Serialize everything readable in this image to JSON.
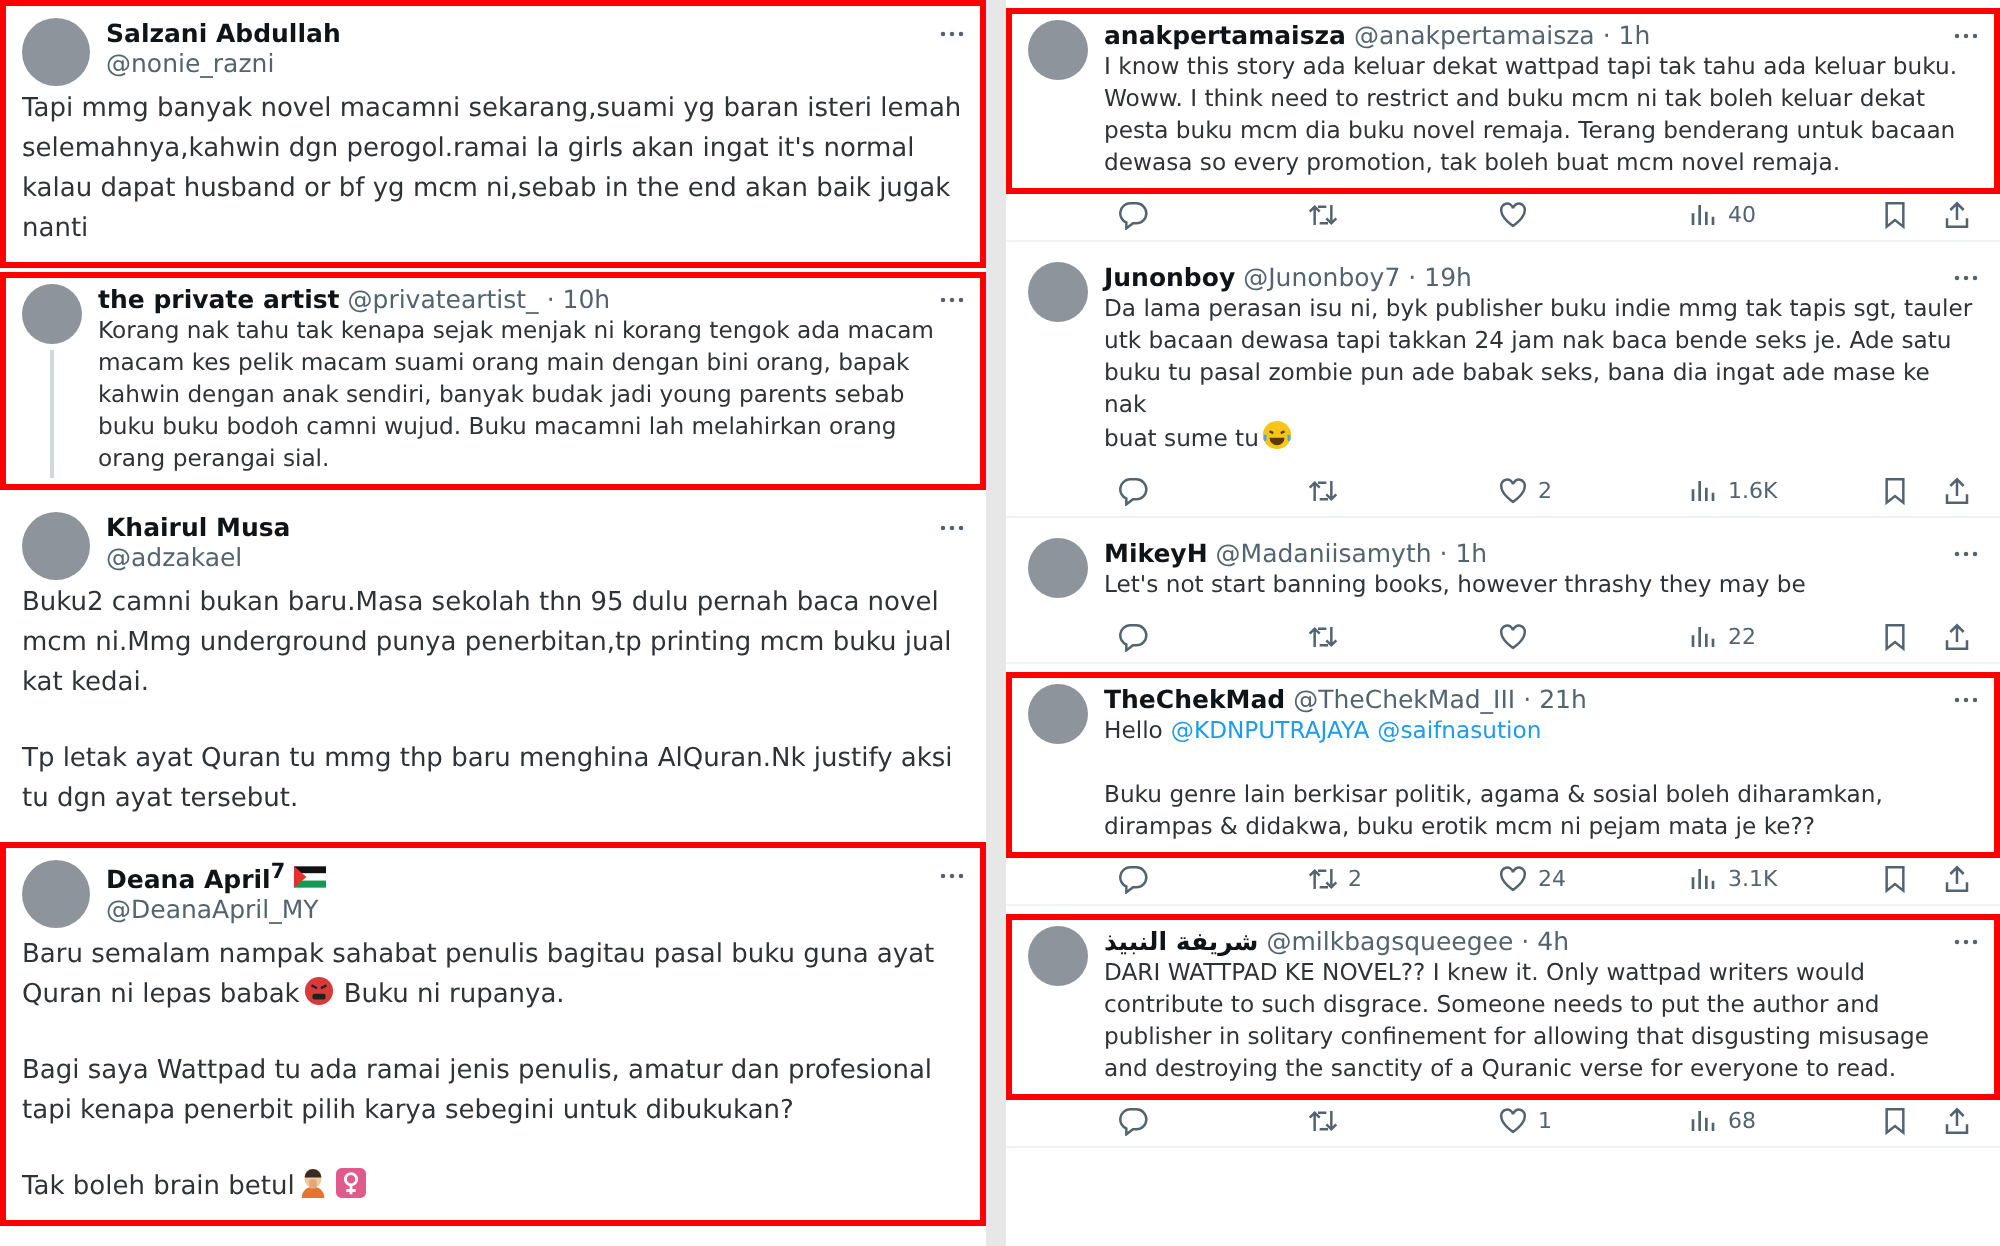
{
  "left_column": [
    {
      "kind": "detail",
      "highlighted": true,
      "name": "Salzani Abdullah",
      "handle": "@nonie_razni",
      "body": [
        [
          {
            "kind": "text",
            "text": "Tapi mmg banyak novel macamni sekarang,suami yg baran isteri lemah selemahnya,kahwin dgn perogol.ramai la girls akan ingat it's normal kalau dapat husband or bf yg mcm ni,sebab in the end akan baik jugak nanti"
          }
        ]
      ]
    },
    {
      "kind": "compact",
      "highlighted": true,
      "thread_line": true,
      "name": "the private artist",
      "handle": "@privateartist_",
      "time": "· 10h",
      "body": [
        [
          {
            "kind": "text",
            "text": "Korang nak tahu tak kenapa sejak menjak ni korang tengok ada macam macam kes pelik macam suami orang main dengan bini orang, bapak kahwin dengan anak sendiri, banyak budak jadi young parents sebab buku buku bodoh camni wujud. Buku macamni lah melahirkan orang orang perangai sial."
          }
        ]
      ]
    },
    {
      "kind": "detail",
      "highlighted": false,
      "name": "Khairul Musa",
      "handle": "@adzakael",
      "body": [
        [
          {
            "kind": "text",
            "text": "Buku2 camni bukan baru.Masa sekolah thn 95 dulu pernah baca novel mcm ni.Mmg underground punya penerbitan,tp printing mcm buku jual kat kedai."
          }
        ],
        [
          {
            "kind": "text",
            "text": "Tp letak ayat Quran tu mmg thp baru menghina AlQuran.Nk justify aksi tu dgn ayat tersebut."
          }
        ]
      ]
    },
    {
      "kind": "detail",
      "highlighted": true,
      "name": "Deana April$^{7}$",
      "flag": true,
      "handle": "@DeanaApril_MY",
      "body": [
        [
          {
            "kind": "text",
            "text": "Baru semalam nampak sahabat penulis bagitau pasal buku guna ayat"
          },
          {
            "kind": "text",
            "text": "Quran ni lepas babak"
          },
          {
            "kind": "icon"
          },
          {
            "kind": "text",
            "text": "Buku ni rupanya."
          }
        ],
        [
          {
            "kind": "text",
            "text": "Bagi saya Wattpad tu ada ramai jenis penulis, amatur dan profesional tapi kenapa penerbit pilih karya sebegini untuk dibukukan?"
          }
        ],
        [
          {
            "kind": "text",
            "text": "Tak boleh brain betul"
          },
          {
            "kind": "icon"
          },
          {
            "kind": "icon"
          }
        ]
      ]
    }
  ],
  "right_column": [
    {
      "highlighted": true,
      "name": "anakpertamaisza",
      "handle": "@anakpertamaisza",
      "time": "· 1h",
      "body": [
        [
          {
            "kind": "text",
            "text": "I know this story ada keluar dekat wattpad tapi tak tahu ada keluar buku. Woww. I think need to restrict and buku mcm ni tak boleh keluar dekat pesta buku mcm dia buku novel remaja. Terang benderang untuk bacaan dewasa so every promotion, tak boleh buat mcm novel remaja."
          }
        ]
      ],
      "stats": {
        "views": "40"
      }
    },
    {
      "highlighted": false,
      "name": "Junonboy",
      "handle": "@Junonboy7",
      "time": "· 19h",
      "body": [
        [
          {
            "kind": "text",
            "text": "Da lama perasan isu ni, byk publisher buku indie mmg tak tapis sgt, tauler utk bacaan dewasa tapi takkan 24 jam nak baca bende seks je. Ade satu buku tu pasal zombie pun ade babak seks, bana dia ingat ade mase ke nak"
          },
          {
            "kind": "text",
            "text": "buat sume tu"
          },
          {
            "kind": "icon"
          }
        ]
      ],
      "stats": {
        "likes": "2",
        "views": "1.6K"
      }
    },
    {
      "highlighted": false,
      "name": "MikeyH",
      "handle": "@Madaniisamyth",
      "time": "· 1h",
      "body": [
        [
          {
            "kind": "text",
            "text": "Let's not start banning books, however thrashy they may be"
          }
        ]
      ],
      "stats": {
        "views": "22"
      }
    },
    {
      "highlighted": true,
      "name": "TheChekMad",
      "handle": "@TheChekMad_III",
      "time": "· 21h",
      "body": [
        [
          {
            "kind": "text",
            "text": "Hello"
          },
          {
            "kind": "mention",
            "text": "@KDNPUTRAJAYA"
          },
          {
            "kind": "mention",
            "text": "@saifnasution"
          }
        ],
        [
          {
            "kind": "text",
            "text": "Buku genre lain berkisar politik, agama & sosial boleh diharamkan, dirampas & didakwa, buku erotik mcm ni pejam mata je ke??"
          }
        ]
      ],
      "stats": {
        "retweets": "2",
        "likes": "24",
        "views": "3.1K"
      }
    },
    {
      "highlighted": true,
      "name": "شريفة النبيذ",
      "handle": "@milkbagsqueegee",
      "time": "· 4h",
      "body": [
        [
          {
            "kind": "text",
            "text": "DARI WATTPAD KE NOVEL?? I knew it. Only wattpad writers would contribute to such disgrace. Someone needs to put the author and publisher in solitary confinement for allowing that disgusting misusage and destroying the sanctity of a Quranic verse for everyone to read."
          }
        ]
      ],
      "stats": {
        "likes": "1",
        "views": "68"
      }
    }
  ]
}
